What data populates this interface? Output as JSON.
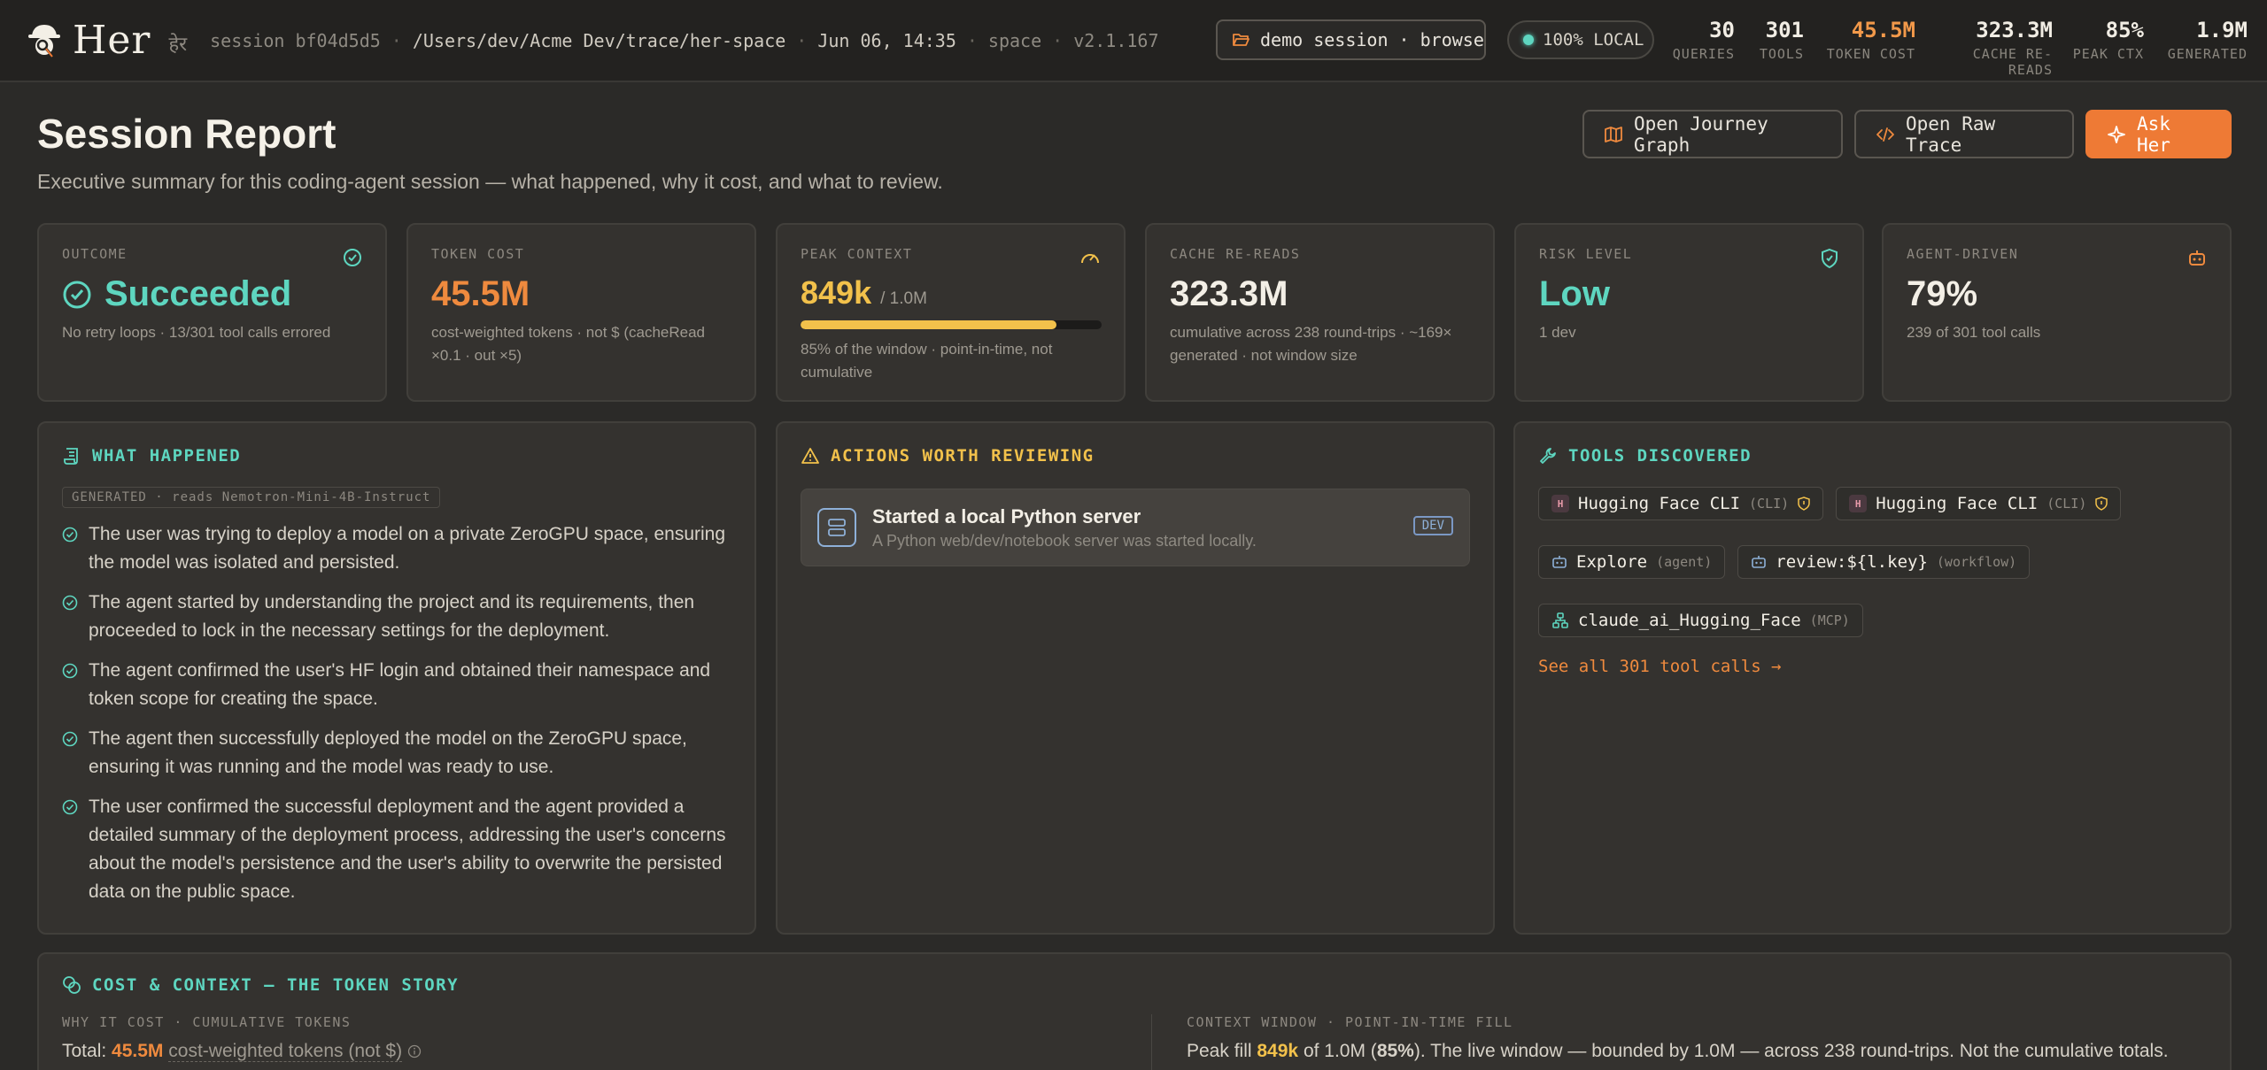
{
  "brand": {
    "name": "Her",
    "hindi": "हेर"
  },
  "session": {
    "id": "session bf04d5d5",
    "path": "/Users/dev/Acme Dev/trace/her-space",
    "datetime": "Jun 06, 14:35",
    "space": "space",
    "version": "v2.1.167"
  },
  "demo_pill": "demo session · browse",
  "local_pill": "100% LOCAL",
  "stats": [
    {
      "value": "30",
      "label": "QUERIES"
    },
    {
      "value": "301",
      "label": "TOOLS"
    },
    {
      "value": "45.5M",
      "label": "TOKEN COST",
      "color": "#f2994a"
    },
    {
      "value": "323.3M",
      "label": "CACHE RE-READS"
    },
    {
      "value": "85%",
      "label": "PEAK CTX"
    },
    {
      "value": "1.9M",
      "label": "GENERATED"
    }
  ],
  "header": {
    "title": "Session Report",
    "subtitle": "Executive summary for this coding-agent session — what happened, why it cost, and what to review.",
    "buttons": {
      "journey": "Open Journey Graph",
      "raw": "Open Raw Trace",
      "ask": "Ask Her"
    }
  },
  "kpis": {
    "outcome": {
      "label": "OUTCOME",
      "value": "Succeeded",
      "note": "No retry loops · 13/301 tool calls errored"
    },
    "token_cost": {
      "label": "TOKEN COST",
      "value": "45.5M",
      "note": "cost-weighted tokens · not $ (cacheRead ×0.1 · out ×5)"
    },
    "peak_context": {
      "label": "PEAK CONTEXT",
      "value": "849k",
      "max": "/ 1.0M",
      "fill_fraction": 0.85,
      "note": "85% of the window · point-in-time, not cumulative"
    },
    "cache": {
      "label": "CACHE RE-READS",
      "value": "323.3M",
      "note": "cumulative across 238 round-trips · ~169× generated · not window size"
    },
    "risk": {
      "label": "RISK LEVEL",
      "value": "Low",
      "note": "1 dev"
    },
    "agent": {
      "label": "AGENT-DRIVEN",
      "value": "79%",
      "note": "239 of 301 tool calls"
    }
  },
  "what_happened": {
    "title": "WHAT HAPPENED",
    "tag": "GENERATED · reads Nemotron-Mini-4B-Instruct",
    "items": [
      "The user was trying to deploy a model on a private ZeroGPU space, ensuring the model was isolated and persisted.",
      "The agent started by understanding the project and its requirements, then proceeded to lock in the necessary settings for the deployment.",
      "The agent confirmed the user's HF login and obtained their namespace and token scope for creating the space.",
      "The agent then successfully deployed the model on the ZeroGPU space, ensuring it was running and the model was ready to use.",
      "The user confirmed the successful deployment and the agent provided a detailed summary of the deployment process, addressing the user's concerns about the model's persistence and the user's ability to overwrite the persisted data on the public space."
    ]
  },
  "actions": {
    "title": "ACTIONS WORTH REVIEWING",
    "items": [
      {
        "title": "Started a local Python server",
        "desc": "A Python web/dev/notebook server was started locally.",
        "badge": "DEV"
      }
    ]
  },
  "tools": {
    "title": "TOOLS DISCOVERED",
    "chips": [
      {
        "name": "Hugging Face CLI",
        "kind": "(CLI)",
        "icon": "hf-icon"
      },
      {
        "name": "Hugging Face CLI",
        "kind": "(CLI)",
        "icon": "hf-icon"
      },
      {
        "name": "Explore",
        "kind": "(agent)",
        "icon": "robot-icon"
      },
      {
        "name": "review:${l.key}",
        "kind": "(workflow)",
        "icon": "robot-icon"
      },
      {
        "name": "claude_ai_Hugging_Face",
        "kind": "(MCP)",
        "icon": "network-icon"
      }
    ],
    "see_all": "See all 301 tool calls →"
  },
  "cost_context": {
    "title": "COST & CONTEXT — THE TOKEN STORY",
    "left_label": "WHY IT COST · CUMULATIVE TOKENS",
    "total_prefix": "Total:",
    "total_value": "45.5M",
    "total_suffix": "cost-weighted tokens (not $)",
    "right_label": "CONTEXT WINDOW · POINT-IN-TIME FILL",
    "peak_prefix": "Peak fill",
    "peak_value": "849k",
    "peak_mid": "of 1.0M (",
    "peak_pct": "85%",
    "peak_suffix": "). The live window — bounded by 1.0M — across 238 round-trips. Not the cumulative totals."
  },
  "colors": {
    "accent": "#ee7a35",
    "teal": "#5ed6c0",
    "yellow": "#f2c14b",
    "bg": "#2b2a28"
  }
}
